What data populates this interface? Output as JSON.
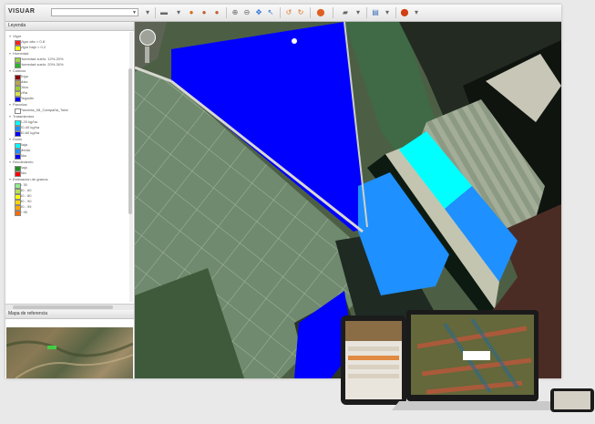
{
  "app": {
    "logo": "VISUAR",
    "logo_sub": "",
    "layer_select": "",
    "colors": {
      "parcel_dark_blue": "#0000ff",
      "parcel_light_blue": "#1e90ff",
      "parcel_cyan": "#00ffff"
    }
  },
  "toolbar": {
    "icons": [
      "dropdown-icon",
      "layer-icon",
      "globe-icon",
      "zoom-in-icon",
      "zoom-out-icon",
      "pan-icon",
      "select-icon",
      "measure-icon",
      "marker-icon",
      "car-icon",
      "document-icon",
      "settings-icon"
    ]
  },
  "sidebar": {
    "legend_title": "Leyenda",
    "reference_title": "Mapa de referencia",
    "groups": [
      {
        "label": "Vigor",
        "items": [
          {
            "label": "Vigor alto > 0.8",
            "color": "#ff2222"
          },
          {
            "label": "Vigor bajo < 0.2",
            "color": "#ffff00"
          }
        ]
      },
      {
        "label": "Humedad",
        "items": [
          {
            "label": "Humedad suelo: 12%-20%",
            "color": "#9bd34a"
          },
          {
            "label": "Humedad suelo: 20%-30%",
            "color": "#2ab52a"
          }
        ]
      },
      {
        "label": "Cultivos",
        "items": [
          {
            "label": "Trigo",
            "color": "#8b0000"
          },
          {
            "label": "Maiz",
            "color": "#b9a34d"
          },
          {
            "label": "Olivo",
            "color": "#9acd32"
          },
          {
            "label": "Viña",
            "color": "#d7e24a"
          },
          {
            "label": "Regadio",
            "color": "#0000ff"
          }
        ]
      },
      {
        "label": "Parcelas",
        "items": [
          {
            "label": "Parcelas_08_Campaña_Total",
            "color": "#ffffff"
          }
        ]
      },
      {
        "label": "Tratamientos",
        "items": [
          {
            "label": "0-20 kg/ha",
            "color": "#00ffff"
          },
          {
            "label": "20-40 kg/ha",
            "color": "#1e90ff"
          },
          {
            "label": "40-60 kg/ha",
            "color": "#0000ff"
          }
        ]
      },
      {
        "label": "Dosis",
        "items": [
          {
            "label": "Baja",
            "color": "#00ffff"
          },
          {
            "label": "Media",
            "color": "#1e90ff"
          },
          {
            "label": "Alta",
            "color": "#0000ff"
          }
        ]
      },
      {
        "label": "Rendimiento",
        "items": [
          {
            "label": "Bajo",
            "color": "#228b22"
          },
          {
            "label": "Alto",
            "color": "#ff0000"
          }
        ]
      },
      {
        "label": "Estimacion de granos",
        "items": [
          {
            "label": "< 30",
            "color": "#90ee90"
          },
          {
            "label": "30 - 60",
            "color": "#b5e050"
          },
          {
            "label": "60 - 80",
            "color": "#ffff00"
          },
          {
            "label": "80 - 90",
            "color": "#ffd700"
          },
          {
            "label": "90 - 95",
            "color": "#ffa500"
          },
          {
            "label": "> 95",
            "color": "#ff6a00"
          }
        ]
      }
    ]
  }
}
